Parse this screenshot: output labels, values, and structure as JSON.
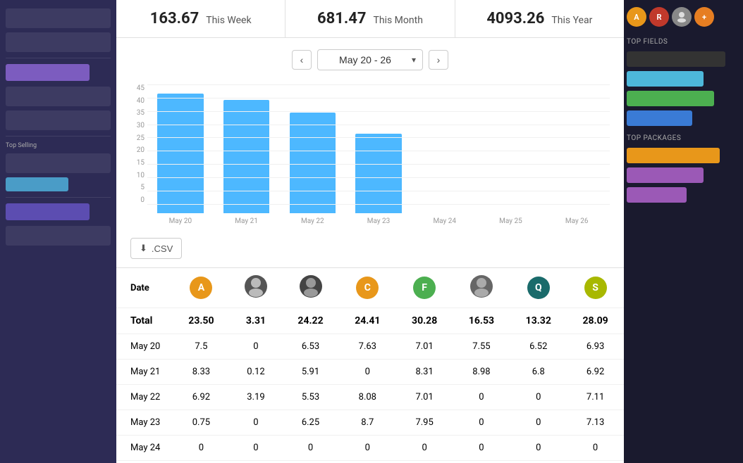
{
  "stats": {
    "week_value": "163.67",
    "week_label": "This Week",
    "month_value": "681.47",
    "month_label": "This Month",
    "year_value": "4093.26",
    "year_label": "This Year"
  },
  "date_nav": {
    "prev_label": "‹",
    "next_label": "›",
    "selected": "May 20 - 26"
  },
  "chart": {
    "y_labels": [
      "0",
      "5",
      "10",
      "15",
      "20",
      "25",
      "30",
      "35",
      "40",
      "45"
    ],
    "bars": [
      {
        "day": "May 20",
        "value": 46,
        "pct": 100
      },
      {
        "day": "May 21",
        "value": 43,
        "pct": 93
      },
      {
        "day": "May 22",
        "value": 38,
        "pct": 82
      },
      {
        "day": "May 23",
        "value": 30,
        "pct": 65
      },
      {
        "day": "May 24",
        "value": 0,
        "pct": 0
      },
      {
        "day": "May 25",
        "value": 0,
        "pct": 0
      },
      {
        "day": "May 26",
        "value": 0,
        "pct": 0
      }
    ],
    "max_value": 46
  },
  "csv_btn": ".CSV",
  "table": {
    "col_date": "Date",
    "col_total": "Total",
    "avatars": [
      {
        "id": "A",
        "type": "letter",
        "color": "#e8971a"
      },
      {
        "id": "B",
        "type": "photo",
        "color": "#888"
      },
      {
        "id": "C2",
        "type": "photo2",
        "color": "#555"
      },
      {
        "id": "C",
        "type": "letter",
        "color": "#e8971a"
      },
      {
        "id": "F",
        "type": "letter",
        "color": "#4caf50"
      },
      {
        "id": "D",
        "type": "photo3",
        "color": "#666"
      },
      {
        "id": "Q",
        "type": "letter",
        "color": "#1a6b6b"
      },
      {
        "id": "S",
        "type": "letter",
        "color": "#a8b800"
      }
    ],
    "totals": [
      "23.50",
      "3.31",
      "24.22",
      "24.41",
      "30.28",
      "16.53",
      "13.32",
      "28.09"
    ],
    "rows": [
      {
        "date": "May 20",
        "vals": [
          "7.5",
          "0",
          "6.53",
          "7.63",
          "7.01",
          "7.55",
          "6.52",
          "6.93"
        ]
      },
      {
        "date": "May 21",
        "vals": [
          "8.33",
          "0.12",
          "5.91",
          "0",
          "8.31",
          "8.98",
          "6.8",
          "6.92"
        ]
      },
      {
        "date": "May 22",
        "vals": [
          "6.92",
          "3.19",
          "5.53",
          "8.08",
          "7.01",
          "0",
          "0",
          "7.11"
        ]
      },
      {
        "date": "May 23",
        "vals": [
          "0.75",
          "0",
          "6.25",
          "8.7",
          "7.95",
          "0",
          "0",
          "7.13"
        ]
      },
      {
        "date": "May 24",
        "vals": [
          "0",
          "0",
          "0",
          "0",
          "0",
          "0",
          "0",
          "0"
        ]
      }
    ]
  },
  "right_panel": {
    "top_label": "Top Fields",
    "bars": [
      {
        "label": "",
        "color": "#333",
        "width": "90%"
      },
      {
        "label": "",
        "color": "#4db8db",
        "width": "70%"
      },
      {
        "label": "",
        "color": "#4caf50",
        "width": "80%"
      },
      {
        "label": "",
        "color": "#3a7bd5",
        "width": "60%"
      }
    ],
    "bottom_label": "Top Packages",
    "bars2": [
      {
        "label": "",
        "color": "#e8971a",
        "width": "85%"
      },
      {
        "label": "",
        "color": "#9b59b6",
        "width": "70%"
      },
      {
        "label": "",
        "color": "#9b59b6",
        "width": "55%"
      }
    ]
  }
}
